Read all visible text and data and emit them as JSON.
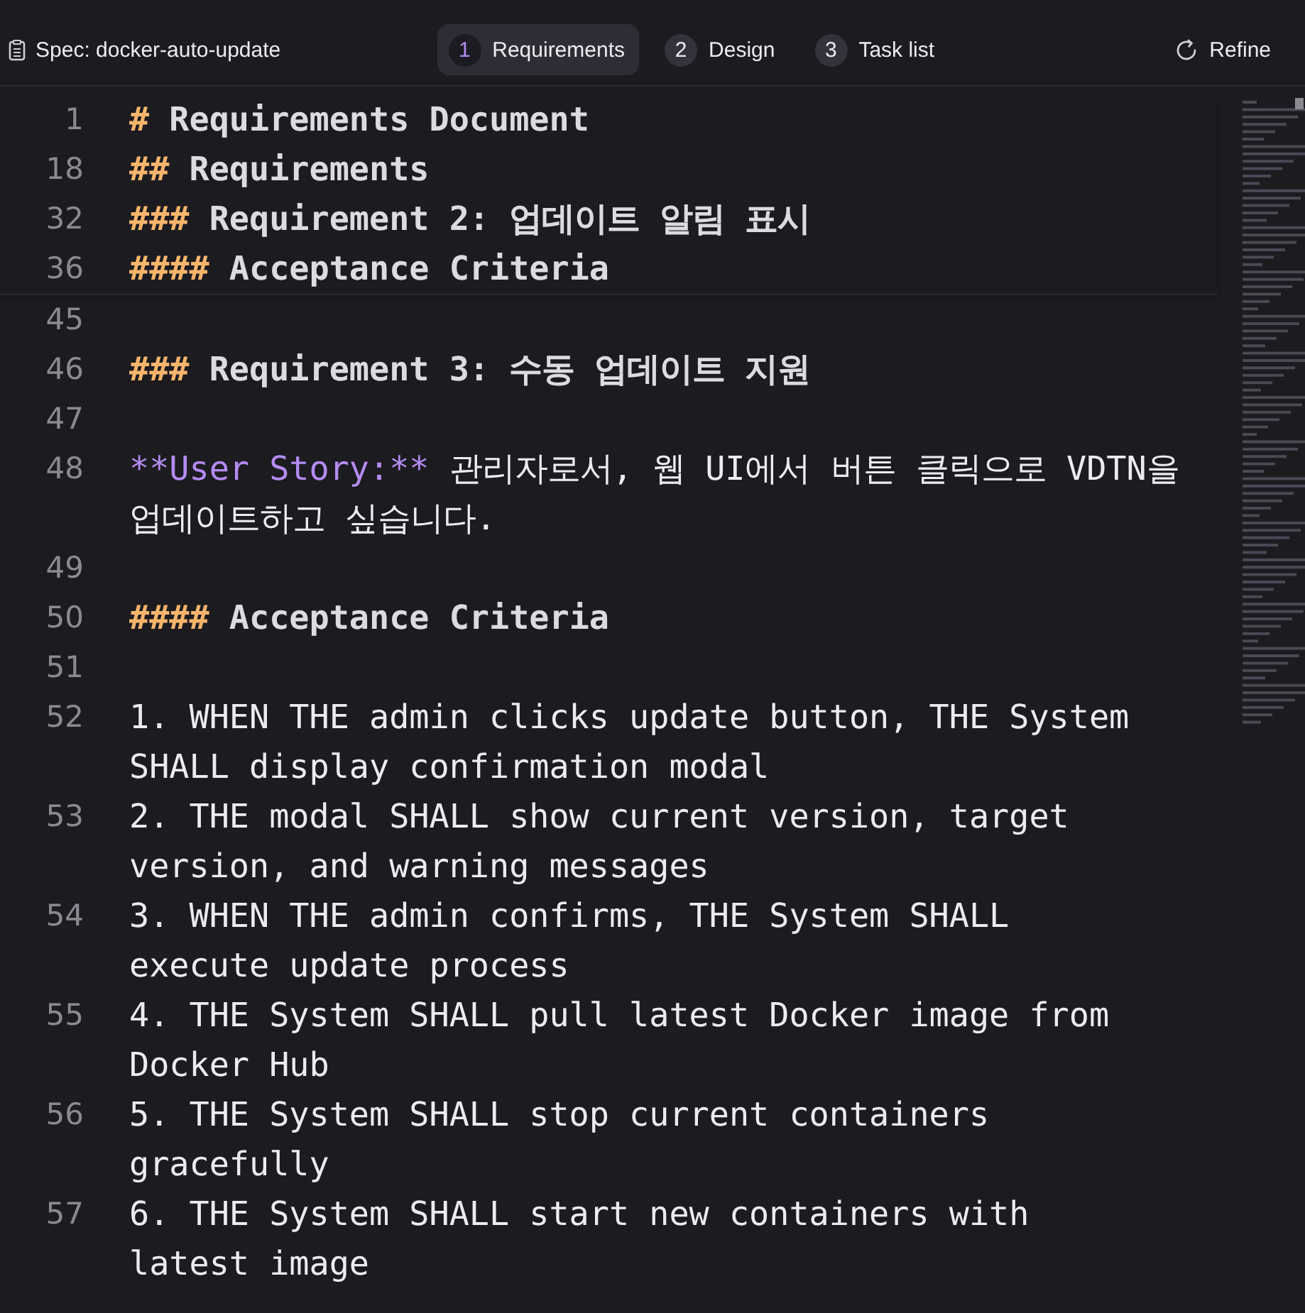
{
  "header": {
    "spec_title": "Spec: docker-auto-update",
    "refine_label": "Refine"
  },
  "tabs": [
    {
      "number": "1",
      "label": "Requirements",
      "selected": true
    },
    {
      "number": "2",
      "label": "Design",
      "selected": false
    },
    {
      "number": "3",
      "label": "Task list",
      "selected": false
    }
  ],
  "sticky_lines": [
    {
      "number": "1",
      "kind": "heading",
      "marker": "#",
      "text": "Requirements Document"
    },
    {
      "number": "18",
      "kind": "heading",
      "marker": "##",
      "text": "Requirements"
    },
    {
      "number": "32",
      "kind": "heading",
      "marker": "###",
      "text": "Requirement 2: 업데이트 알림 표시"
    },
    {
      "number": "36",
      "kind": "heading",
      "marker": "####",
      "text": "Acceptance Criteria"
    }
  ],
  "lines": [
    {
      "number": "45",
      "kind": "blank"
    },
    {
      "number": "46",
      "kind": "heading",
      "marker": "###",
      "text": "Requirement 3: 수동 업데이트 지원"
    },
    {
      "number": "47",
      "kind": "blank"
    },
    {
      "number": "48",
      "kind": "emphasis",
      "marker": "**User Story:**",
      "text": "관리자로서, 웹 UI에서 버튼 클릭으로 VDTN을 업데이트하고 싶습니다."
    },
    {
      "number": "49",
      "kind": "blank"
    },
    {
      "number": "50",
      "kind": "heading",
      "marker": "####",
      "text": "Acceptance Criteria"
    },
    {
      "number": "51",
      "kind": "blank"
    },
    {
      "number": "52",
      "kind": "text",
      "text": "1. WHEN THE admin clicks update button, THE System SHALL display confirmation modal"
    },
    {
      "number": "53",
      "kind": "text",
      "text": "2. THE modal SHALL show current version, target version, and warning messages"
    },
    {
      "number": "54",
      "kind": "text",
      "text": "3. WHEN THE admin confirms, THE System SHALL execute update process"
    },
    {
      "number": "55",
      "kind": "text",
      "text": "4. THE System SHALL pull latest Docker image from Docker Hub"
    },
    {
      "number": "56",
      "kind": "text",
      "text": "5. THE System SHALL stop current containers gracefully"
    },
    {
      "number": "57",
      "kind": "text",
      "text": "6. THE System SHALL start new containers with latest image"
    }
  ]
}
